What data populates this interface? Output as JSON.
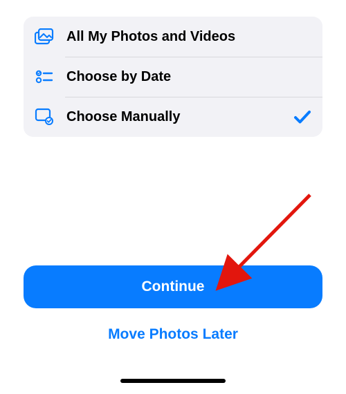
{
  "options": [
    {
      "icon": "photos-icon",
      "label": "All My Photos and Videos",
      "selected": false
    },
    {
      "icon": "list-icon",
      "label": "Choose by Date",
      "selected": false
    },
    {
      "icon": "select-icon",
      "label": "Choose Manually",
      "selected": true
    }
  ],
  "buttons": {
    "primary": "Continue",
    "secondary": "Move Photos Later"
  },
  "colors": {
    "accent": "#087cff",
    "annotation": "#e2160d"
  }
}
